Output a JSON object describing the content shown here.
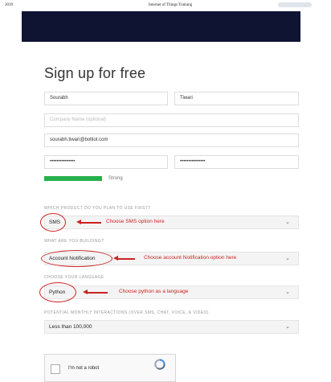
{
  "topbar": {
    "year": "2019",
    "title": "Internet of Things Training"
  },
  "heading": "Sign up for free",
  "form": {
    "first_name": "Sourabh",
    "last_name": "Tiwari",
    "company_placeholder": "Company Name (optional)",
    "email": "sourabh.tiwari@boltiot.com",
    "password_mask": "•••••••••••••••",
    "confirm_mask": "•••••••••••••••",
    "strength_label": "Strong",
    "strength_level": 1.0,
    "strength_color": "#26b14c"
  },
  "questions": [
    {
      "label": "WHICH PRODUCT DO YOU PLAN TO USE FIRST?",
      "value": "SMS",
      "note": "Choose SMS option here"
    },
    {
      "label": "WHAT ARE YOU BUILDING?",
      "value": "Account Notification",
      "note": "Choose account Notification option here"
    },
    {
      "label": "CHOOSE YOUR LANGUAGE",
      "value": "Python",
      "note": "Choose python as a language"
    },
    {
      "label": "POTENTIAL MONTHLY INTERACTIONS (OVER SMS, CHAT, VOICE, & VIDEO)",
      "value": "Less than 100,000",
      "note": ""
    }
  ],
  "captcha": {
    "label": "I'm not a robot"
  },
  "icons": {
    "chevron": "chevron-down-icon",
    "recaptcha": "recaptcha-logo-icon"
  },
  "colors": {
    "banner": "#0f1433",
    "annotation": "#cc2222"
  }
}
